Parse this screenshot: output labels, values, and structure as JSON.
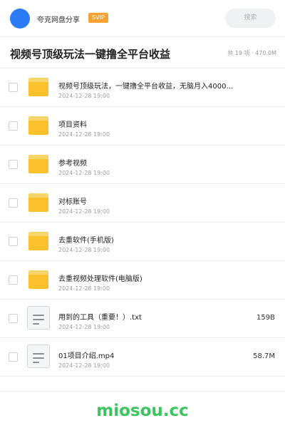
{
  "header": {
    "share_name": "夸克网盘分享",
    "badge": "SVIP",
    "search_placeholder": "搜索"
  },
  "folder": {
    "title": "视频号顶级玩法一键撸全平台收益",
    "summary": "共 19 项 · 470.0M"
  },
  "items": [
    {
      "name": "视频号顶级玩法，一键撸全平台收益，无脑月入4000…",
      "date": "2024-12-28 19:00",
      "type": "folder",
      "size": ""
    },
    {
      "name": "项目资料",
      "date": "2024-12-28 19:00",
      "type": "folder",
      "size": ""
    },
    {
      "name": "参考视频",
      "date": "2024-12-28 19:00",
      "type": "folder",
      "size": ""
    },
    {
      "name": "对标账号",
      "date": "2024-12-28 19:00",
      "type": "folder",
      "size": ""
    },
    {
      "name": "去重软件(手机版)",
      "date": "2024-12-28 19:00",
      "type": "folder",
      "size": ""
    },
    {
      "name": "去重视频处理软件(电脑版)",
      "date": "2024-12-28 19:00",
      "type": "folder",
      "size": ""
    },
    {
      "name": "用到的工具（重要！）.txt",
      "date": "2024-12-28 19:00",
      "type": "file",
      "size": "159B"
    },
    {
      "name": "01项目介绍.mp4",
      "date": "2024-12-28 19:00",
      "type": "file",
      "size": "58.7M"
    }
  ],
  "watermark": "miosou.cc"
}
